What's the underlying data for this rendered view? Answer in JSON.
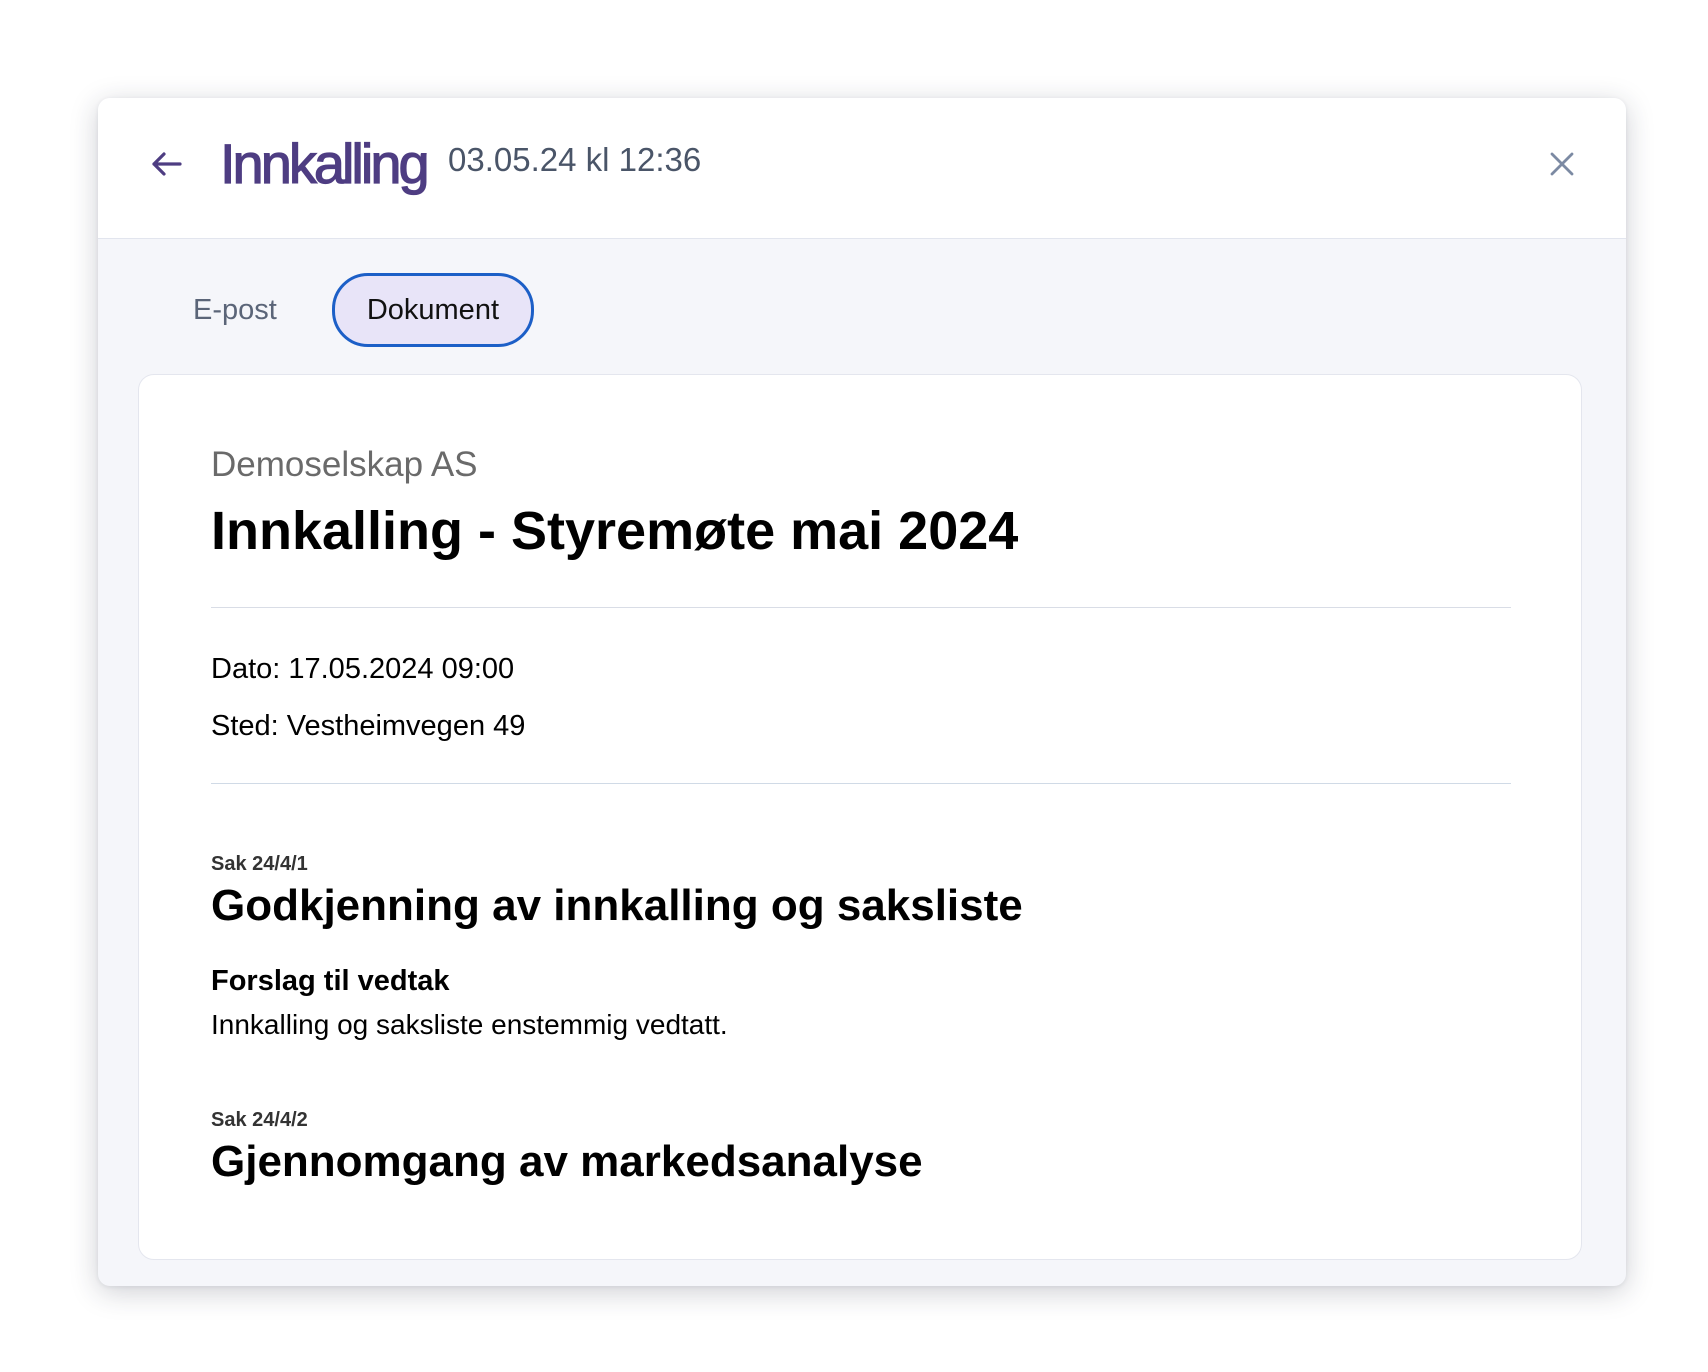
{
  "header": {
    "title": "Innkalling",
    "timestamp": "03.05.24 kl 12:36",
    "back_icon": "arrow-left-icon",
    "close_icon": "close-icon"
  },
  "tabs": [
    {
      "label": "E-post",
      "active": false
    },
    {
      "label": "Dokument",
      "active": true
    }
  ],
  "document": {
    "company": "Demoselskap AS",
    "title": "Innkalling - Styremøte mai 2024",
    "date_line": "Dato: 17.05.2024 09:00",
    "place_line": "Sted: Vestheimvegen 49",
    "items": [
      {
        "code": "Sak 24/4/1",
        "title": "Godkjenning av innkalling og saksliste",
        "proposal_heading": "Forslag til vedtak",
        "proposal_text": "Innkalling og saksliste enstemmig vedtatt."
      },
      {
        "code": "Sak 24/4/2",
        "title": "Gjennomgang av markedsanalyse"
      }
    ]
  },
  "colors": {
    "brand": "#4e3d82",
    "tab_active_bg": "#e8e4f8",
    "tab_active_border": "#1c5fc7",
    "modal_bg": "#f5f6fa"
  }
}
